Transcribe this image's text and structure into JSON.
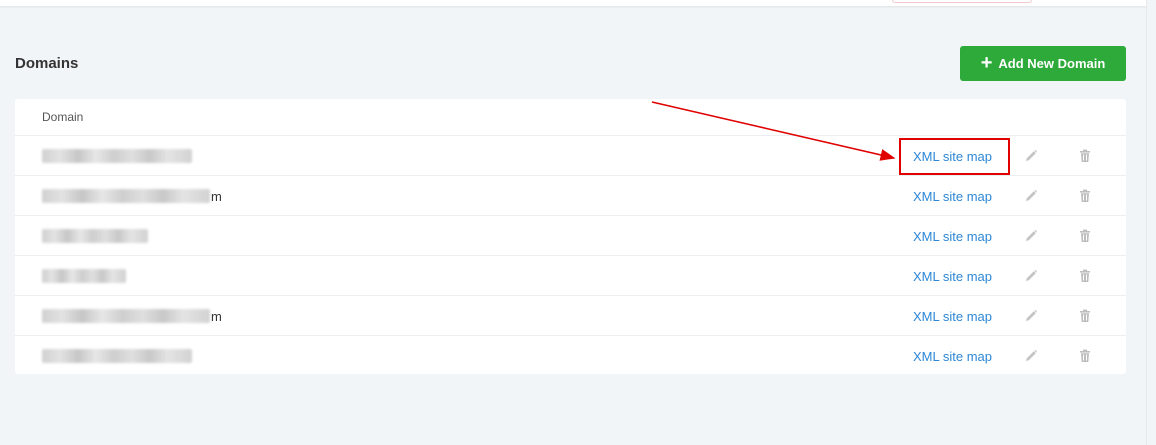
{
  "header": {
    "title": "Domains",
    "add_button_label": "Add New Domain"
  },
  "table": {
    "column_header": "Domain",
    "link_label": "XML site map",
    "rows": [
      {
        "domain_visible_suffix": ""
      },
      {
        "domain_visible_suffix": "m"
      },
      {
        "domain_visible_suffix": ""
      },
      {
        "domain_visible_suffix": ""
      },
      {
        "domain_visible_suffix": "m"
      },
      {
        "domain_visible_suffix": ""
      }
    ]
  },
  "icons": {
    "add": "plus-icon",
    "edit": "pencil-icon",
    "delete": "trash-icon"
  },
  "colors": {
    "accent_green": "#2eaa3a",
    "link_blue": "#2d87d6",
    "annotation_red": "#e00000"
  }
}
